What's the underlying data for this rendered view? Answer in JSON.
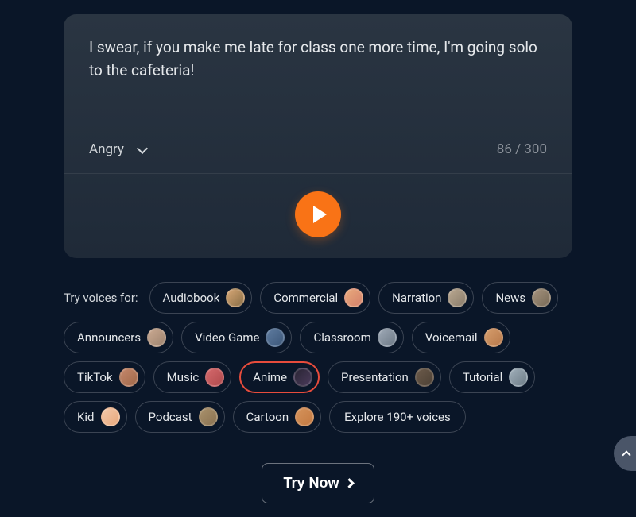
{
  "editor": {
    "text": "I swear, if you make me late for class one more time, I'm going solo to the cafeteria!",
    "emotion": "Angry",
    "char_count": "86 / 300"
  },
  "voices": {
    "label": "Try voices for:",
    "items": [
      {
        "label": "Audiobook",
        "avatar_class": "c1",
        "selected": false
      },
      {
        "label": "Commercial",
        "avatar_class": "c2",
        "selected": false
      },
      {
        "label": "Narration",
        "avatar_class": "c3",
        "selected": false
      },
      {
        "label": "News",
        "avatar_class": "c4",
        "selected": false
      },
      {
        "label": "Announcers",
        "avatar_class": "c5",
        "selected": false
      },
      {
        "label": "Video Game",
        "avatar_class": "c6",
        "selected": false
      },
      {
        "label": "Classroom",
        "avatar_class": "c7",
        "selected": false
      },
      {
        "label": "Voicemail",
        "avatar_class": "c8",
        "selected": false
      },
      {
        "label": "TikTok",
        "avatar_class": "c9",
        "selected": false
      },
      {
        "label": "Music",
        "avatar_class": "c10",
        "selected": false
      },
      {
        "label": "Anime",
        "avatar_class": "c11",
        "selected": true
      },
      {
        "label": "Presentation",
        "avatar_class": "c12",
        "selected": false
      },
      {
        "label": "Tutorial",
        "avatar_class": "c13",
        "selected": false
      },
      {
        "label": "Kid",
        "avatar_class": "c14",
        "selected": false
      },
      {
        "label": "Podcast",
        "avatar_class": "c15",
        "selected": false
      },
      {
        "label": "Cartoon",
        "avatar_class": "c16",
        "selected": false
      }
    ],
    "explore_label": "Explore 190+ voices"
  },
  "cta": {
    "label": "Try Now"
  }
}
